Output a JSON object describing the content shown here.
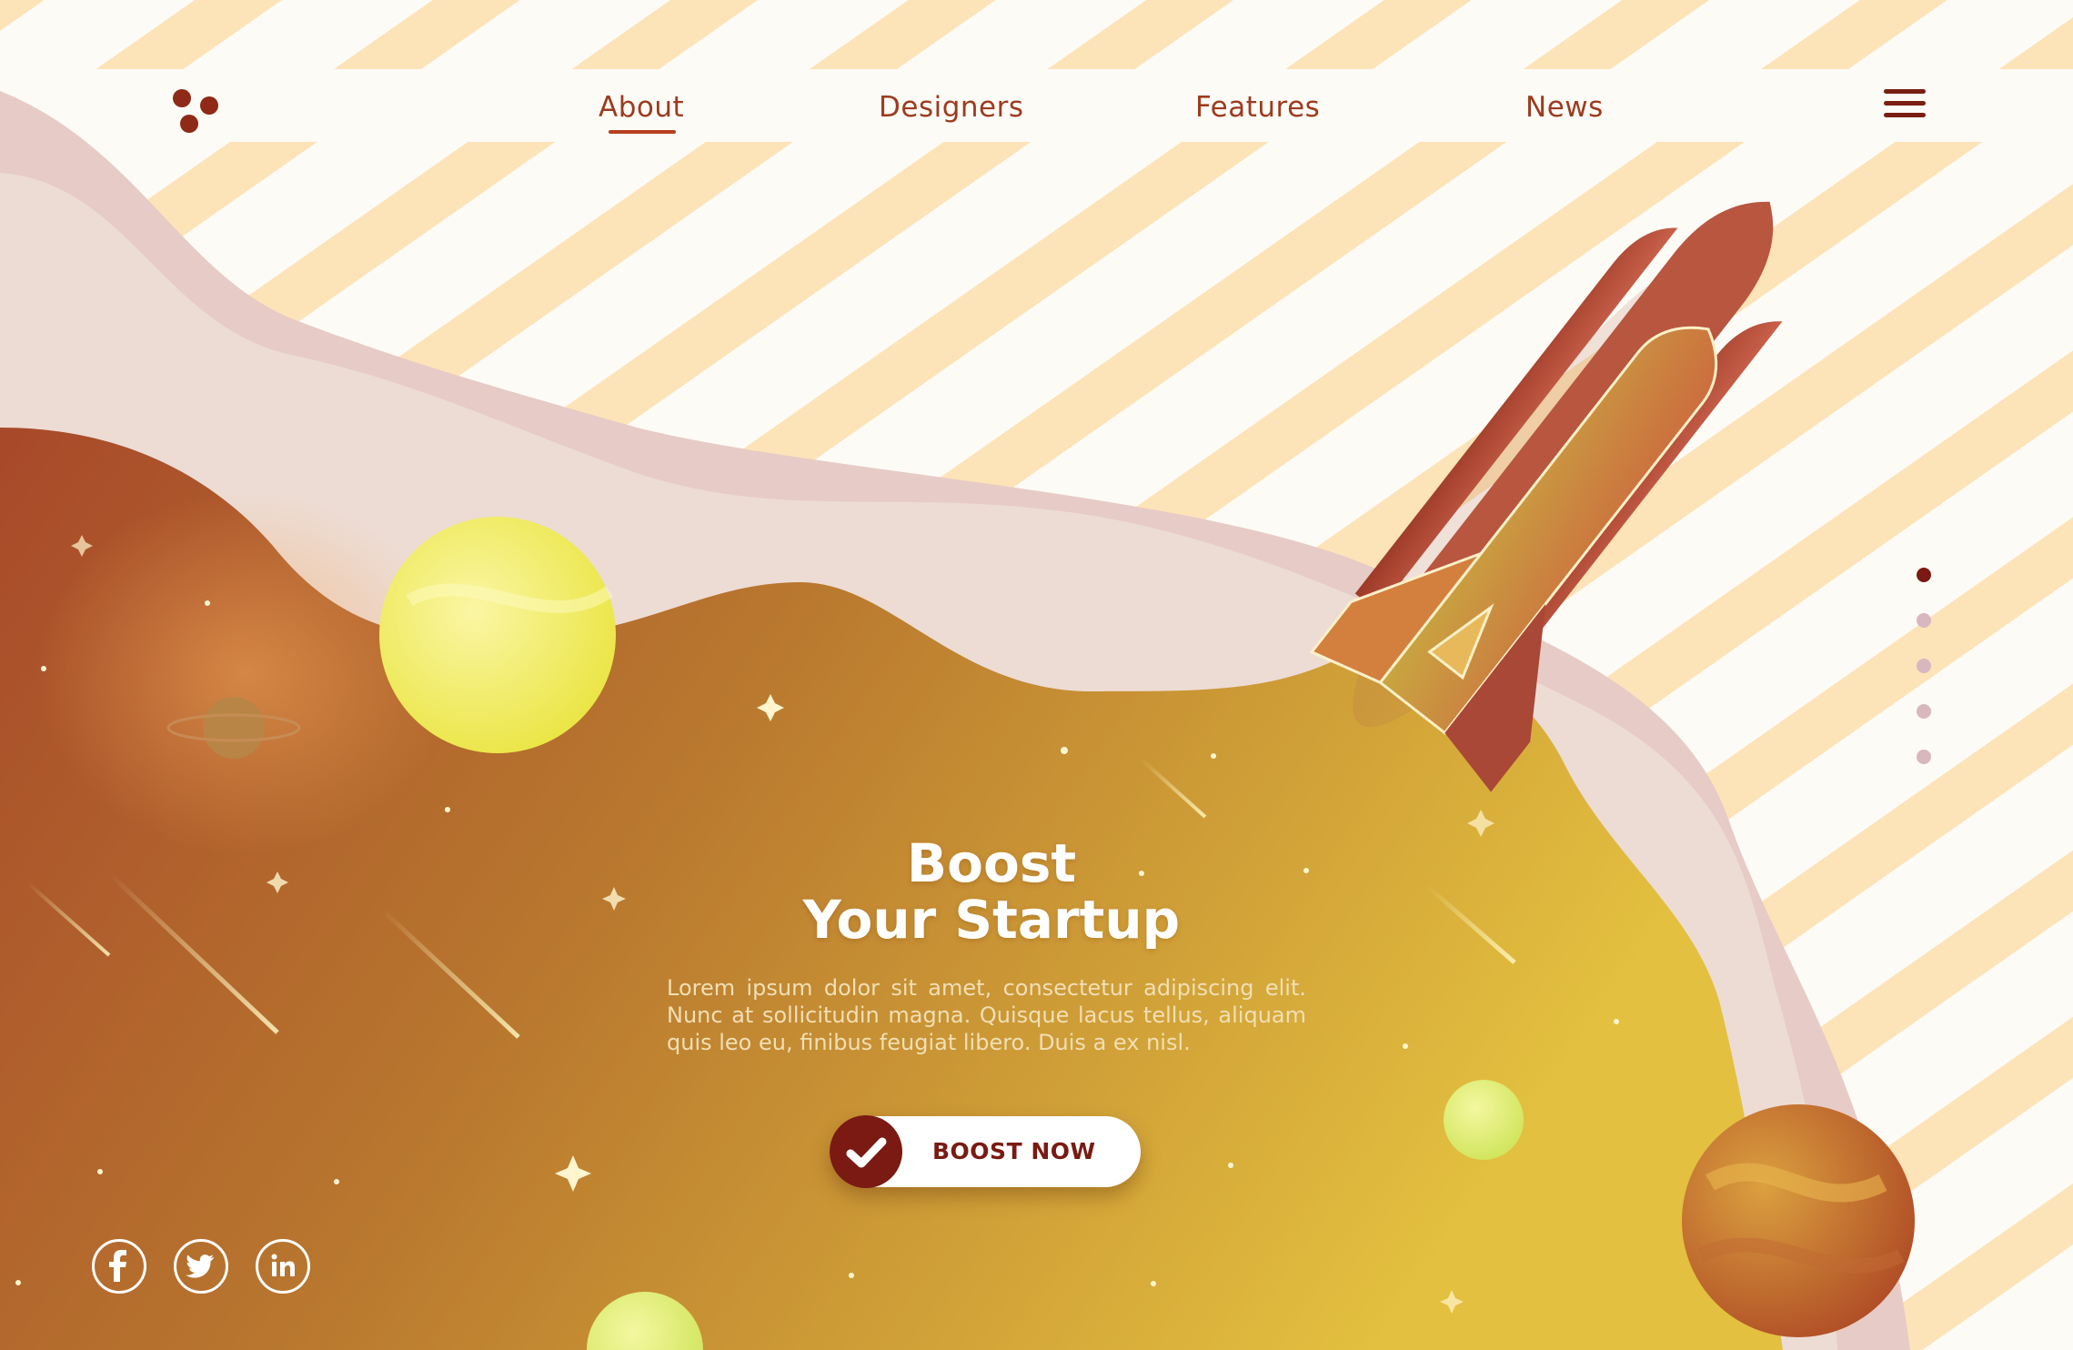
{
  "brand": {
    "logo_icon": "three-dots-logo-icon"
  },
  "nav": {
    "items": [
      {
        "label": "About",
        "active": true
      },
      {
        "label": "Designers"
      },
      {
        "label": "Features"
      },
      {
        "label": "News"
      }
    ],
    "menu_icon": "hamburger-menu-icon"
  },
  "hero": {
    "title_line1": "Boost",
    "title_line2": "Your Startup",
    "description": "Lorem ipsum dolor sit amet, consectetur adipiscing elit. Nunc at sollicitudin magna. Quisque lacus tellus, aliquam quis leo eu, finibus feugiat libero. Duis a ex nisl.",
    "cta": {
      "label": "BOOST NOW",
      "icon": "check-icon"
    }
  },
  "pagination": {
    "count": 5,
    "active_index": 0
  },
  "social": [
    {
      "icon": "facebook-icon"
    },
    {
      "icon": "twitter-icon"
    },
    {
      "icon": "linkedin-icon"
    }
  ],
  "colors": {
    "accent": "#7a1a12",
    "nav_text": "#9c3b1f",
    "stripe": "#fde3b8",
    "background": "#fdfbf6",
    "gradient_left": "#a8492a",
    "gradient_right": "#e2bd3f"
  }
}
